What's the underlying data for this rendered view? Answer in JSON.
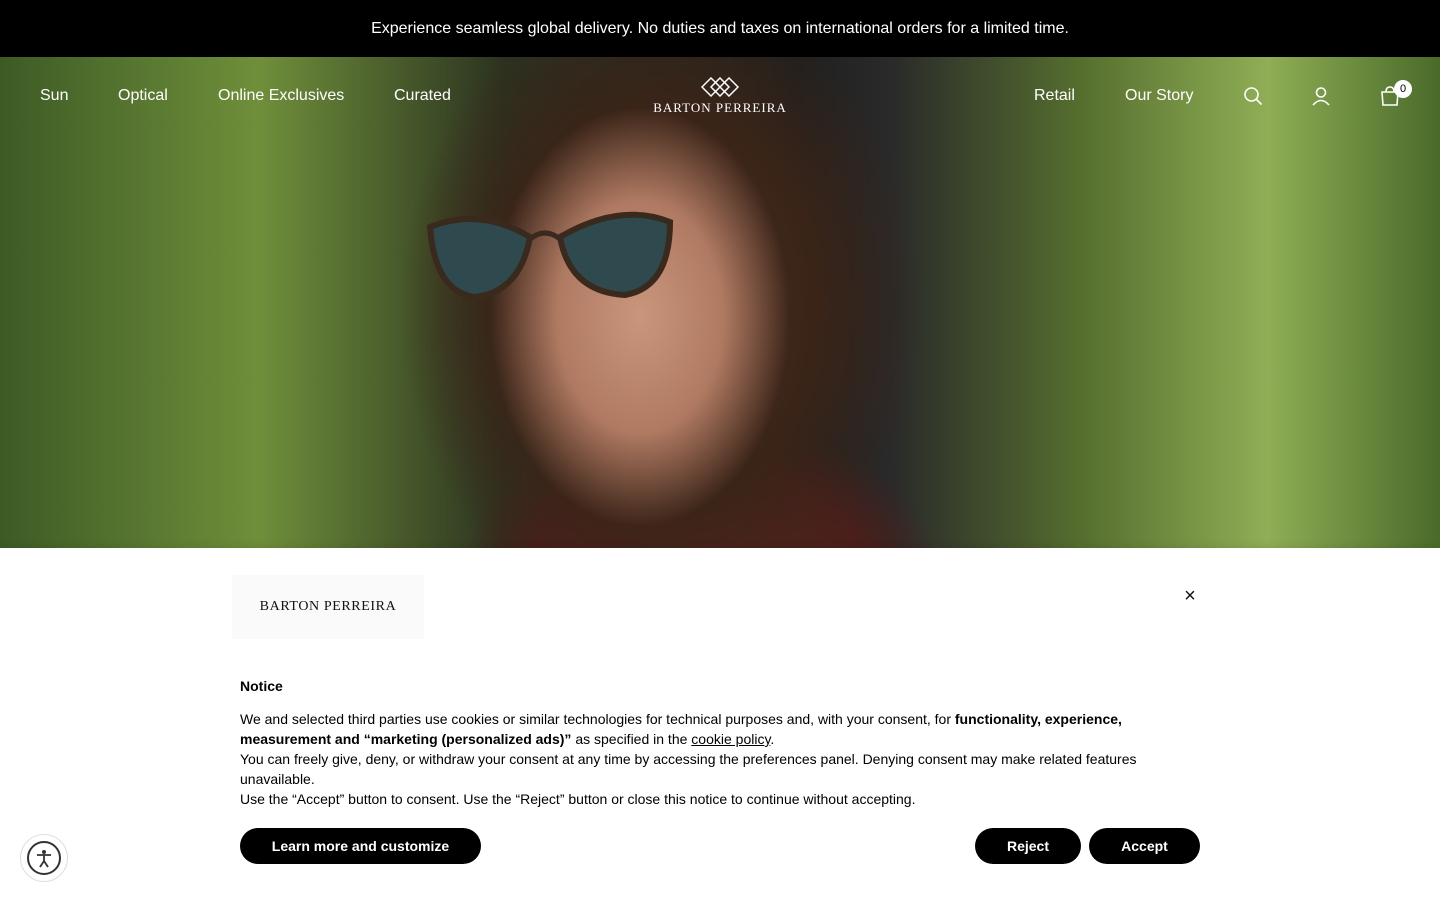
{
  "announcement": "Experience seamless global delivery. No duties and taxes on international orders for a limited time.",
  "nav": {
    "left": [
      "Sun",
      "Optical",
      "Online Exclusives",
      "Curated"
    ],
    "right": [
      "Retail",
      "Our Story"
    ],
    "logo_text": "BARTON PERREIRA",
    "cart_count": "0",
    "icons": [
      "search-icon",
      "account-icon",
      "cart-icon"
    ]
  },
  "cookie": {
    "logo_text": "BARTON PERREIRA",
    "close_label": "×",
    "title": "Notice",
    "line1_a": "We and selected third parties use cookies or similar technologies for technical purposes and, with your consent, for ",
    "line1_bold": "functionality, experience, measurement and “marketing (personalized ads)”",
    "line1_b": " as specified in the ",
    "line1_link": "cookie policy",
    "line1_end": ".",
    "line2": "You can freely give, deny, or withdraw your consent at any time by accessing the preferences panel. Denying consent may make related features unavailable.",
    "line3": "Use the “Accept” button to consent. Use the “Reject” button or close this notice to continue without accepting.",
    "learn_more": "Learn more and customize",
    "reject": "Reject",
    "accept": "Accept"
  },
  "colors": {
    "announcement_bg": "#000000",
    "button_bg": "#000000",
    "button_text": "#ffffff"
  }
}
